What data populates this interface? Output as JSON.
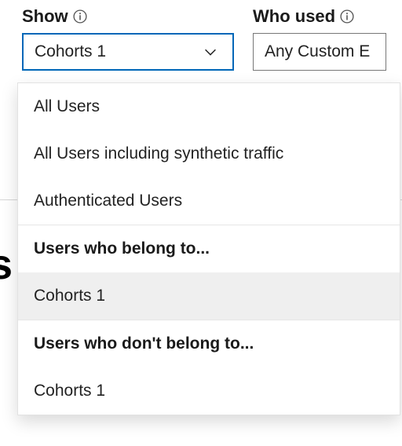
{
  "filters": {
    "show": {
      "label": "Show",
      "selected": "Cohorts 1"
    },
    "who_used": {
      "label": "Who used",
      "selected": "Any Custom E"
    }
  },
  "dropdown": {
    "general_items": [
      "All Users",
      "All Users including synthetic traffic",
      "Authenticated Users"
    ],
    "belong_header": "Users who belong to...",
    "belong_items": [
      "Cohorts 1"
    ],
    "not_belong_header": "Users who don't belong to...",
    "not_belong_items": [
      "Cohorts 1"
    ]
  },
  "background_char": "s"
}
